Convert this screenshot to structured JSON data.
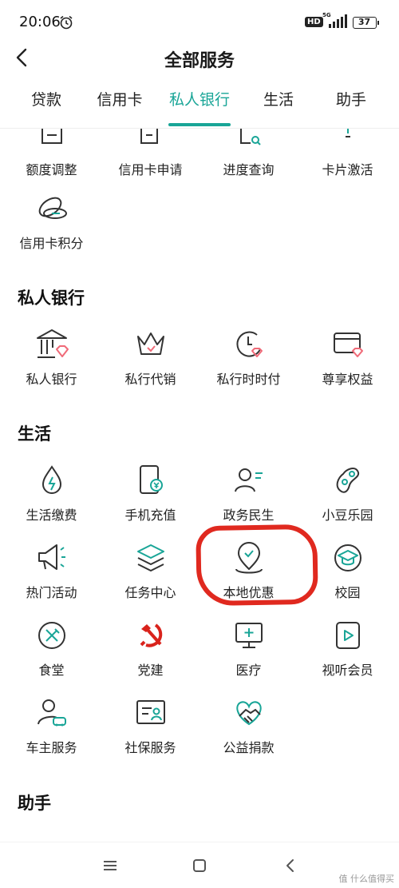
{
  "status": {
    "time": "20:06",
    "hd": "HD",
    "network": "5G",
    "battery": "37"
  },
  "header": {
    "title": "全部服务"
  },
  "tabs": [
    {
      "label": "贷款"
    },
    {
      "label": "信用卡"
    },
    {
      "label": "私人银行",
      "active": true
    },
    {
      "label": "生活"
    },
    {
      "label": "助手"
    }
  ],
  "credit_card": {
    "items": [
      {
        "label": "额度调整",
        "icon": "limit-adjust-icon"
      },
      {
        "label": "信用卡申请",
        "icon": "card-apply-icon"
      },
      {
        "label": "进度查询",
        "icon": "progress-query-icon"
      },
      {
        "label": "卡片激活",
        "icon": "card-activate-icon"
      },
      {
        "label": "信用卡积分",
        "icon": "points-icon"
      }
    ]
  },
  "private_banking": {
    "title": "私人银行",
    "items": [
      {
        "label": "私人银行",
        "icon": "bank-building-icon"
      },
      {
        "label": "私行代销",
        "icon": "crown-icon"
      },
      {
        "label": "私行时时付",
        "icon": "clock-icon"
      },
      {
        "label": "尊享权益",
        "icon": "card-diamond-icon"
      }
    ]
  },
  "life": {
    "title": "生活",
    "items": [
      {
        "label": "生活缴费",
        "icon": "water-drop-icon"
      },
      {
        "label": "手机充值",
        "icon": "phone-recharge-icon"
      },
      {
        "label": "政务民生",
        "icon": "person-list-icon"
      },
      {
        "label": "小豆乐园",
        "icon": "bean-icon"
      },
      {
        "label": "热门活动",
        "icon": "megaphone-icon"
      },
      {
        "label": "任务中心",
        "icon": "layers-icon"
      },
      {
        "label": "本地优惠",
        "icon": "location-pin-icon"
      },
      {
        "label": "校园",
        "icon": "graduation-cap-icon"
      },
      {
        "label": "食堂",
        "icon": "utensils-icon"
      },
      {
        "label": "党建",
        "icon": "hammer-sickle-icon"
      },
      {
        "label": "医疗",
        "icon": "medical-monitor-icon"
      },
      {
        "label": "视听会员",
        "icon": "video-play-icon"
      },
      {
        "label": "车主服务",
        "icon": "car-owner-icon"
      },
      {
        "label": "社保服务",
        "icon": "social-security-icon"
      },
      {
        "label": "公益捐款",
        "icon": "handshake-heart-icon"
      }
    ]
  },
  "assistant": {
    "title": "助手"
  },
  "watermark": "值 什么值得买",
  "colors": {
    "accent": "#19a597",
    "diamond": "#f06a78",
    "annotation": "#e0291f",
    "text": "#222222"
  }
}
